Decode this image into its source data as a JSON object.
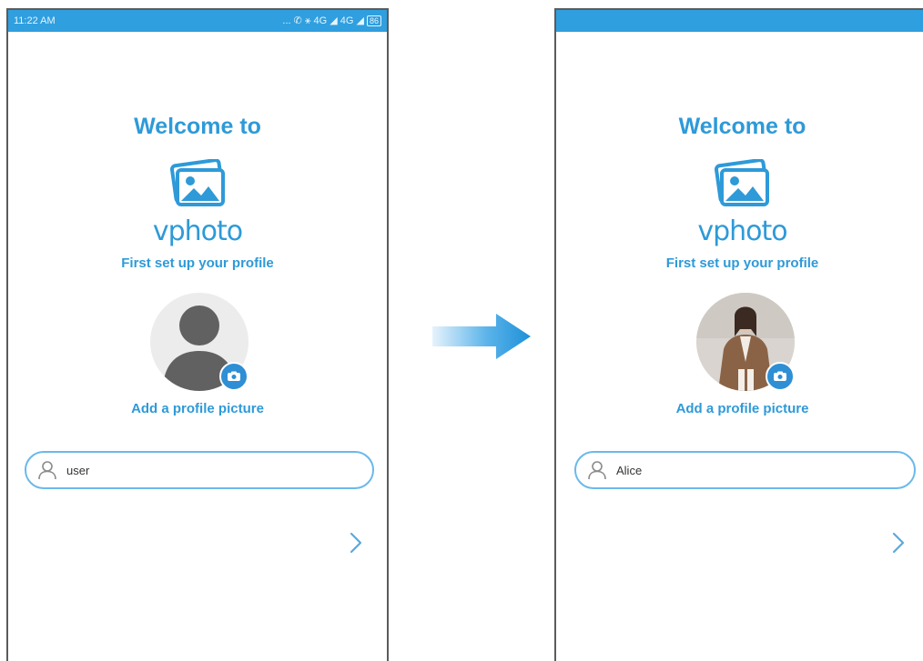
{
  "screens": [
    {
      "status_bar": {
        "time": "11:22 AM",
        "indicators": "... ✆ ⚹ 4G ◢ 4G ◢",
        "battery": "86"
      },
      "welcome": "Welcome to",
      "brand": "vphoto",
      "subtitle": "First set up your profile",
      "avatar": {
        "state": "placeholder",
        "icon": "person-silhouette-icon"
      },
      "add_picture_label": "Add a profile picture",
      "name_field": {
        "value": "user",
        "icon": "user-icon"
      },
      "next_icon": "chevron-right-icon"
    },
    {
      "status_bar": {
        "time": "",
        "indicators": "",
        "battery": ""
      },
      "welcome": "Welcome to",
      "brand": "vphoto",
      "subtitle": "First set up your profile",
      "avatar": {
        "state": "photo",
        "icon": "profile-photo"
      },
      "add_picture_label": "Add a profile picture",
      "name_field": {
        "value": "Alice",
        "icon": "user-icon"
      },
      "next_icon": "chevron-right-icon"
    }
  ],
  "colors": {
    "accent": "#2e9ad8",
    "status_bar": "#2f9fdf",
    "field_border": "#6ab9ea",
    "arrow": "#1e90d8"
  }
}
